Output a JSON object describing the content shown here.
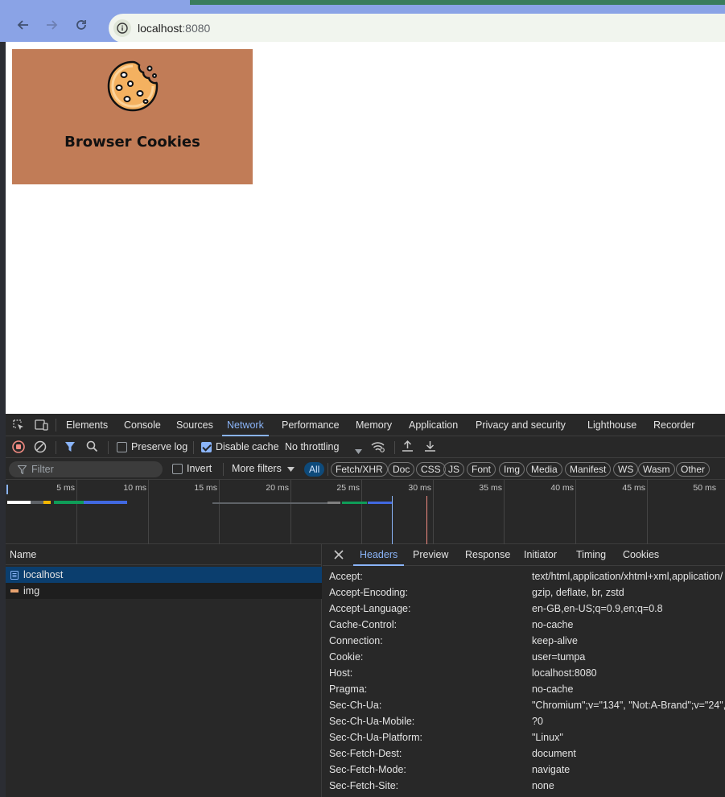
{
  "browser": {
    "url_host": "localhost",
    "url_port": ":8080",
    "back_icon": "arrow-left-icon",
    "forward_icon": "arrow-right-icon",
    "reload_icon": "reload-icon",
    "site_info_icon": "info-icon"
  },
  "page": {
    "banner_title": "Browser Cookies",
    "banner_icon": "cookie-icon",
    "banner_color": "#c17c57"
  },
  "devtools": {
    "tabs": [
      "Elements",
      "Console",
      "Sources",
      "Network",
      "Performance",
      "Memory",
      "Application",
      "Privacy and security",
      "Lighthouse",
      "Recorder"
    ],
    "active_tab": "Network",
    "toolbar": {
      "preserve_log": "Preserve log",
      "disable_cache": "Disable cache",
      "throttling": "No throttling"
    },
    "filter": {
      "placeholder": "Filter",
      "invert": "Invert",
      "more_filters": "More filters"
    },
    "type_chips": [
      "All",
      "Fetch/XHR",
      "Doc",
      "CSS",
      "JS",
      "Font",
      "Img",
      "Media",
      "Manifest",
      "WS",
      "Wasm",
      "Other"
    ],
    "timeline_ticks": [
      "5 ms",
      "10 ms",
      "15 ms",
      "20 ms",
      "25 ms",
      "30 ms",
      "35 ms",
      "40 ms",
      "45 ms",
      "50 ms"
    ],
    "list": {
      "column_name": "Name",
      "requests": [
        {
          "name": "localhost",
          "type": "document"
        },
        {
          "name": "img",
          "type": "image"
        }
      ]
    },
    "detail_tabs": [
      "Headers",
      "Preview",
      "Response",
      "Initiator",
      "Timing",
      "Cookies"
    ],
    "active_detail_tab": "Headers",
    "headers": [
      {
        "name": "Accept:",
        "value": "text/html,application/xhtml+xml,application/"
      },
      {
        "name": "Accept-Encoding:",
        "value": "gzip, deflate, br, zstd"
      },
      {
        "name": "Accept-Language:",
        "value": "en-GB,en-US;q=0.9,en;q=0.8"
      },
      {
        "name": "Cache-Control:",
        "value": "no-cache"
      },
      {
        "name": "Connection:",
        "value": "keep-alive"
      },
      {
        "name": "Cookie:",
        "value": "user=tumpa"
      },
      {
        "name": "Host:",
        "value": "localhost:8080"
      },
      {
        "name": "Pragma:",
        "value": "no-cache"
      },
      {
        "name": "Sec-Ch-Ua:",
        "value": "\"Chromium\";v=\"134\", \"Not:A-Brand\";v=\"24\", \""
      },
      {
        "name": "Sec-Ch-Ua-Mobile:",
        "value": "?0"
      },
      {
        "name": "Sec-Ch-Ua-Platform:",
        "value": "\"Linux\""
      },
      {
        "name": "Sec-Fetch-Dest:",
        "value": "document"
      },
      {
        "name": "Sec-Fetch-Mode:",
        "value": "navigate"
      },
      {
        "name": "Sec-Fetch-Site:",
        "value": "none"
      }
    ],
    "accent_color": "#8ab4f8"
  }
}
